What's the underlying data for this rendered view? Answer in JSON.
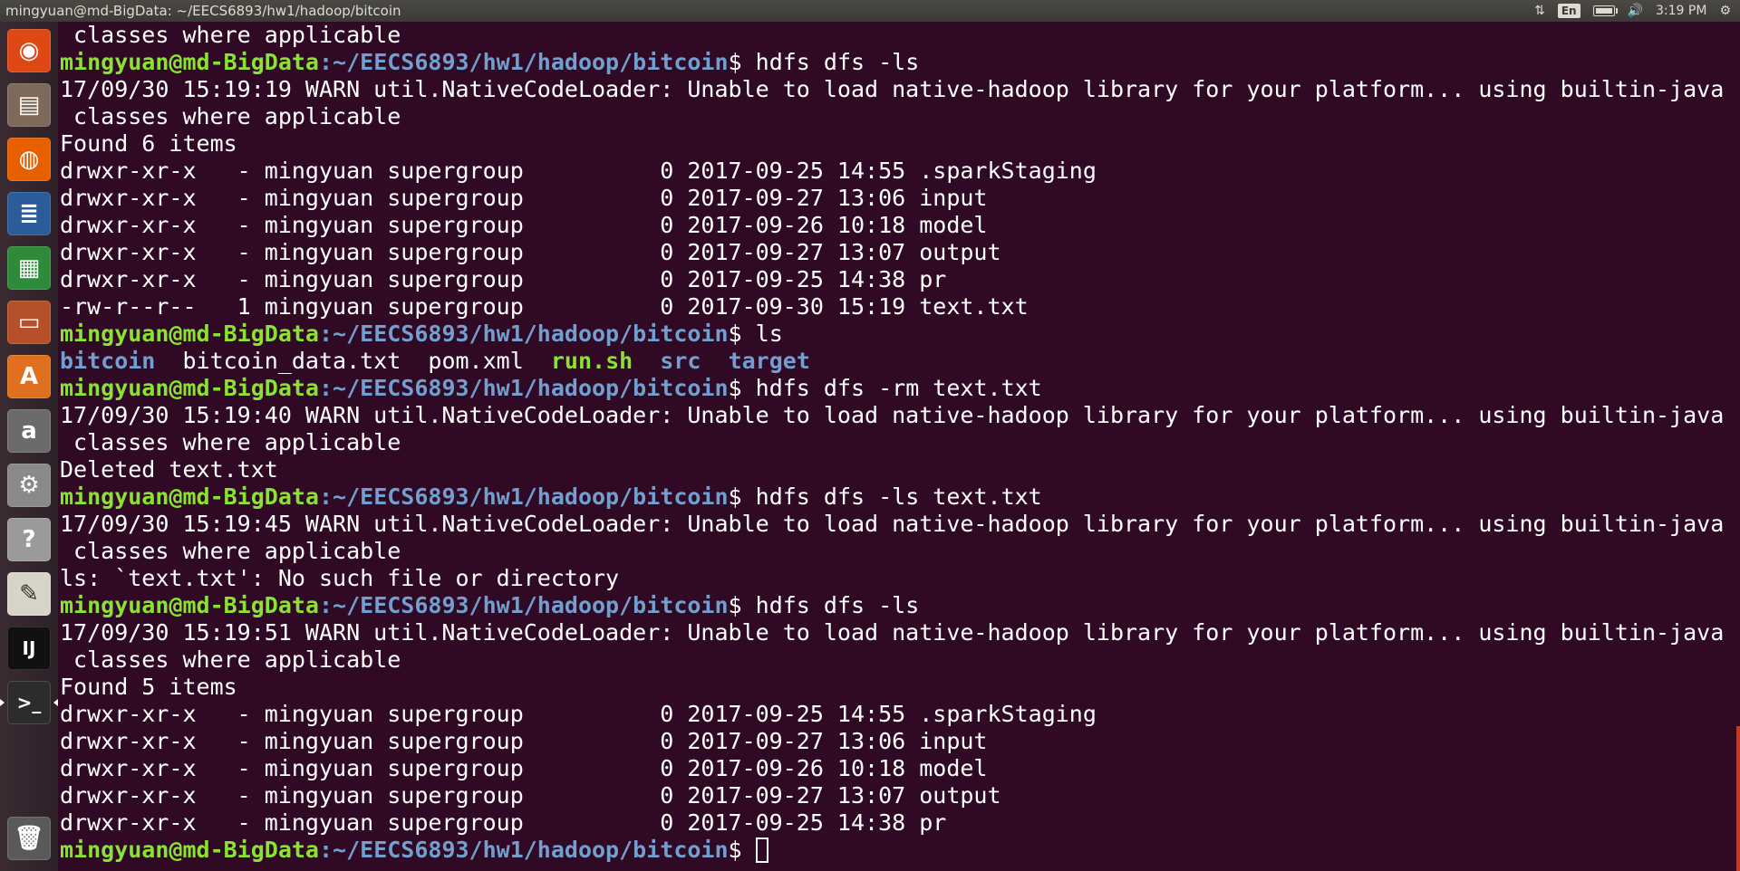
{
  "window": {
    "title": "mingyuan@md-BigData: ~/EECS6893/hw1/hadoop/bitcoin"
  },
  "indicators": {
    "network": "⇅",
    "keyboard": "En",
    "volume": "🔊",
    "time": "3:19 PM",
    "settings": "⚙"
  },
  "launcher": {
    "items": [
      {
        "name": "ubuntu-dash-icon",
        "glyph": "◉",
        "bg": "#dd4814"
      },
      {
        "name": "files-icon",
        "glyph": "▤",
        "bg": "#7d6a5a"
      },
      {
        "name": "firefox-icon",
        "glyph": "◍",
        "bg": "#e66000"
      },
      {
        "name": "libreoffice-writer-icon",
        "glyph": "≣",
        "bg": "#2a5c9a"
      },
      {
        "name": "libreoffice-calc-icon",
        "glyph": "▦",
        "bg": "#2e8b3a"
      },
      {
        "name": "libreoffice-impress-icon",
        "glyph": "▭",
        "bg": "#b5502a"
      },
      {
        "name": "software-center-icon",
        "glyph": "A",
        "bg": "#e07020"
      },
      {
        "name": "amazon-icon",
        "glyph": "a",
        "bg": "#6b6b6b"
      },
      {
        "name": "system-settings-icon",
        "glyph": "⚙",
        "bg": "#8a8a8a"
      },
      {
        "name": "help-icon",
        "glyph": "?",
        "bg": "#9a9a9a"
      },
      {
        "name": "text-editor-icon",
        "glyph": "✎",
        "bg": "#d8d4c8"
      },
      {
        "name": "intellij-icon",
        "glyph": "IJ",
        "bg": "#111111"
      },
      {
        "name": "terminal-icon",
        "glyph": ">_",
        "bg": "#2c2c2c"
      }
    ],
    "trash": {
      "name": "trash-icon",
      "glyph": "🗑",
      "bg": "#5a5a5a"
    }
  },
  "prompt": {
    "user_host": "mingyuan@md-BigData",
    "path": ":~/EECS6893/hw1/hadoop/bitcoin",
    "sign": "$ "
  },
  "terminal": {
    "lines": [
      {
        "type": "text",
        "text": " classes where applicable"
      },
      {
        "type": "prompt",
        "cmd": "hdfs dfs -ls"
      },
      {
        "type": "text",
        "text": "17/09/30 15:19:19 WARN util.NativeCodeLoader: Unable to load native-hadoop library for your platform... using builtin-java"
      },
      {
        "type": "text",
        "text": " classes where applicable"
      },
      {
        "type": "text",
        "text": "Found 6 items"
      },
      {
        "type": "text",
        "text": "drwxr-xr-x   - mingyuan supergroup          0 2017-09-25 14:55 .sparkStaging"
      },
      {
        "type": "text",
        "text": "drwxr-xr-x   - mingyuan supergroup          0 2017-09-27 13:06 input"
      },
      {
        "type": "text",
        "text": "drwxr-xr-x   - mingyuan supergroup          0 2017-09-26 10:18 model"
      },
      {
        "type": "text",
        "text": "drwxr-xr-x   - mingyuan supergroup          0 2017-09-27 13:07 output"
      },
      {
        "type": "text",
        "text": "drwxr-xr-x   - mingyuan supergroup          0 2017-09-25 14:38 pr"
      },
      {
        "type": "text",
        "text": "-rw-r--r--   1 mingyuan supergroup          0 2017-09-30 15:19 text.txt"
      },
      {
        "type": "prompt",
        "cmd": "ls"
      },
      {
        "type": "ls",
        "items": [
          {
            "text": "bitcoin",
            "kind": "dir"
          },
          {
            "text": "  ",
            "kind": "plain"
          },
          {
            "text": "bitcoin_data.txt",
            "kind": "plain"
          },
          {
            "text": "  ",
            "kind": "plain"
          },
          {
            "text": "pom.xml",
            "kind": "plain"
          },
          {
            "text": "  ",
            "kind": "plain"
          },
          {
            "text": "run.sh",
            "kind": "exe"
          },
          {
            "text": "  ",
            "kind": "plain"
          },
          {
            "text": "src",
            "kind": "dir"
          },
          {
            "text": "  ",
            "kind": "plain"
          },
          {
            "text": "target",
            "kind": "dir"
          }
        ]
      },
      {
        "type": "prompt",
        "cmd": "hdfs dfs -rm text.txt"
      },
      {
        "type": "text",
        "text": "17/09/30 15:19:40 WARN util.NativeCodeLoader: Unable to load native-hadoop library for your platform... using builtin-java"
      },
      {
        "type": "text",
        "text": " classes where applicable"
      },
      {
        "type": "text",
        "text": "Deleted text.txt"
      },
      {
        "type": "prompt",
        "cmd": "hdfs dfs -ls text.txt"
      },
      {
        "type": "text",
        "text": "17/09/30 15:19:45 WARN util.NativeCodeLoader: Unable to load native-hadoop library for your platform... using builtin-java"
      },
      {
        "type": "text",
        "text": " classes where applicable"
      },
      {
        "type": "text",
        "text": "ls: `text.txt': No such file or directory"
      },
      {
        "type": "prompt",
        "cmd": "hdfs dfs -ls"
      },
      {
        "type": "text",
        "text": "17/09/30 15:19:51 WARN util.NativeCodeLoader: Unable to load native-hadoop library for your platform... using builtin-java"
      },
      {
        "type": "text",
        "text": " classes where applicable"
      },
      {
        "type": "text",
        "text": "Found 5 items"
      },
      {
        "type": "text",
        "text": "drwxr-xr-x   - mingyuan supergroup          0 2017-09-25 14:55 .sparkStaging"
      },
      {
        "type": "text",
        "text": "drwxr-xr-x   - mingyuan supergroup          0 2017-09-27 13:06 input"
      },
      {
        "type": "text",
        "text": "drwxr-xr-x   - mingyuan supergroup          0 2017-09-26 10:18 model"
      },
      {
        "type": "text",
        "text": "drwxr-xr-x   - mingyuan supergroup          0 2017-09-27 13:07 output"
      },
      {
        "type": "text",
        "text": "drwxr-xr-x   - mingyuan supergroup          0 2017-09-25 14:38 pr"
      },
      {
        "type": "prompt",
        "cmd": "",
        "cursor": true
      }
    ]
  }
}
